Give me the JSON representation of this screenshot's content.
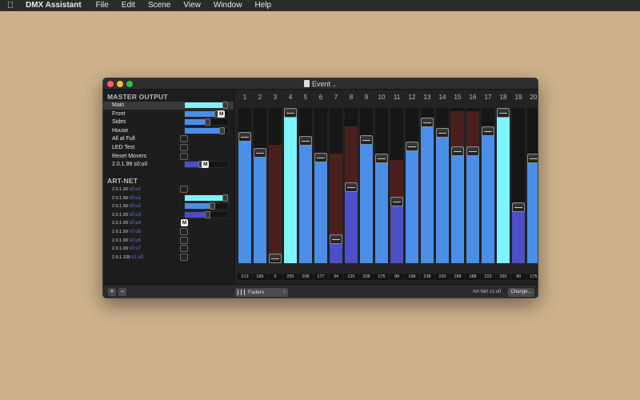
{
  "menubar": {
    "app_name": "DMX Assistant",
    "items": [
      "File",
      "Edit",
      "Scene",
      "View",
      "Window",
      "Help"
    ]
  },
  "window": {
    "title": "Event"
  },
  "sidebar": {
    "master_header": "MASTER OUTPUT",
    "master_rows": [
      {
        "label": "Main",
        "fader": 1.0,
        "color": "#7ff4ff",
        "selected": true
      },
      {
        "label": "Front",
        "fader": 0.82,
        "color": "#4a8ee8",
        "badge": "M"
      },
      {
        "label": "Sides",
        "fader": 0.6,
        "color": "#4a8ee8"
      },
      {
        "label": "House",
        "fader": 0.93,
        "color": "#4a8ee8"
      },
      {
        "label": "All at Full",
        "checkbox": true
      },
      {
        "label": "LED Test",
        "checkbox": true
      },
      {
        "label": "Reset Movers",
        "checkbox": true
      },
      {
        "label": "2.0.1.99 s0:u0",
        "fader": 0.45,
        "color": "#4c4fc6",
        "badge": "M"
      }
    ],
    "artnet_header": "ART-NET",
    "artnet_rows": [
      {
        "ip": "2.0.1.99",
        "universe": "s0:u0",
        "checkbox": true
      },
      {
        "ip": "2.0.1.99",
        "universe": "s0:u1",
        "fader": 1.0,
        "color": "#7ff4ff"
      },
      {
        "ip": "2.0.1.99",
        "universe": "s0:u2",
        "fader": 0.7,
        "color": "#4a8ee8"
      },
      {
        "ip": "2.0.1.99",
        "universe": "s0:u3",
        "fader": 0.6,
        "color": "#4c4fc6"
      },
      {
        "ip": "2.0.1.99",
        "universe": "s0:u4",
        "badge_only": "M"
      },
      {
        "ip": "2.0.1.99",
        "universe": "s0:u5",
        "checkbox": true
      },
      {
        "ip": "2.0.1.99",
        "universe": "s0:u6",
        "checkbox": true
      },
      {
        "ip": "2.0.1.99",
        "universe": "s0:u7",
        "checkbox": true
      },
      {
        "ip": "2.0.1.100",
        "universe": "s1:u0",
        "checkbox": true
      }
    ]
  },
  "channels": {
    "numbers": [
      "1",
      "2",
      "3",
      "4",
      "5",
      "6",
      "7",
      "8",
      "9",
      "10",
      "11",
      "12",
      "13",
      "14",
      "15",
      "16",
      "17",
      "18",
      "19",
      "20"
    ],
    "values": [
      213,
      185,
      0,
      255,
      206,
      177,
      34,
      125,
      208,
      175,
      99,
      196,
      238,
      220,
      188,
      188,
      223,
      255,
      90,
      175
    ],
    "ghost_values": [
      0,
      0,
      195,
      0,
      0,
      0,
      180,
      225,
      0,
      0,
      170,
      0,
      0,
      0,
      250,
      250,
      0,
      0,
      0,
      0
    ],
    "colors": {
      "blue": "#4a8ee8",
      "cyan": "#7ff4ff",
      "indigo": "#4c4fc6",
      "ghost": "#4a201e"
    }
  },
  "bottom": {
    "add_label": "+",
    "remove_label": "−",
    "view_select": "Faders",
    "port_label": "Art-Net s1:u0",
    "change_label": "Change..."
  }
}
